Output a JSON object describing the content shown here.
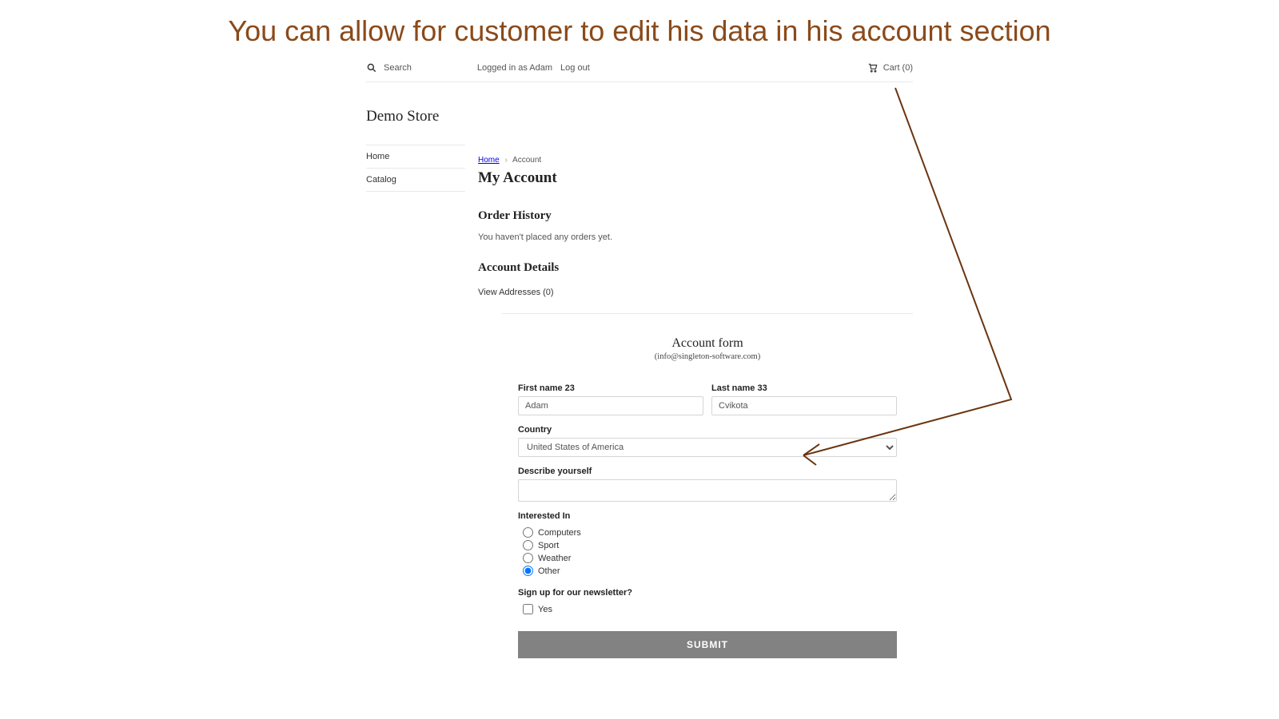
{
  "caption": "You can allow for customer to edit his data in his account section",
  "topbar": {
    "search_label": "Search",
    "logged_in_as": "Logged in as Adam",
    "log_out": "Log out",
    "cart_label": "Cart (0)"
  },
  "store_title": "Demo Store",
  "sidebar": {
    "items": [
      "Home",
      "Catalog"
    ]
  },
  "breadcrumb": {
    "home": "Home",
    "current": "Account"
  },
  "page": {
    "title": "My Account",
    "order_history_heading": "Order History",
    "order_history_empty": "You haven't placed any orders yet.",
    "account_details_heading": "Account Details",
    "view_addresses": "View Addresses (0)"
  },
  "form": {
    "title": "Account form",
    "subtitle": "(info@singleton-software.com)",
    "first_name_label": "First name 23",
    "first_name_value": "Adam",
    "last_name_label": "Last name 33",
    "last_name_value": "Cvikota",
    "country_label": "Country",
    "country_value": "United States of America",
    "describe_label": "Describe yourself",
    "describe_value": "",
    "interested_label": "Interested In",
    "interested_options": [
      {
        "label": "Computers",
        "checked": false
      },
      {
        "label": "Sport",
        "checked": false
      },
      {
        "label": "Weather",
        "checked": false
      },
      {
        "label": "Other",
        "checked": true
      }
    ],
    "newsletter_label": "Sign up for our newsletter?",
    "newsletter_option": {
      "label": "Yes",
      "checked": false
    },
    "submit_label": "SUBMIT"
  }
}
